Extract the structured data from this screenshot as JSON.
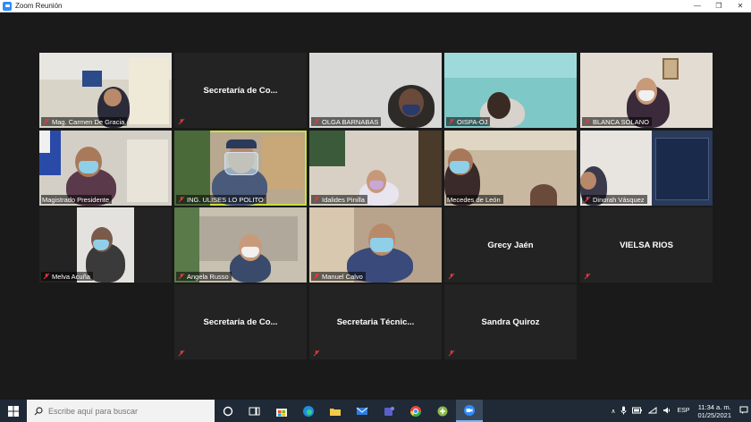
{
  "window": {
    "title": "Zoom Reunión",
    "minimize": "—",
    "restore": "❐",
    "close": "✕"
  },
  "participants": [
    {
      "name": "Mag. Carmen De Gracia",
      "video": true
    },
    {
      "name": "Secretaría de Co...",
      "video": false
    },
    {
      "name": "OLGA BARNABAS",
      "video": true
    },
    {
      "name": "OISPA-OJ",
      "video": true
    },
    {
      "name": "BLANCA SOLANO",
      "video": true
    },
    {
      "name": "Magistrado Presidente",
      "video": true
    },
    {
      "name": "ING. ULISES LO POLITO",
      "video": true,
      "active_speaker": true
    },
    {
      "name": "Idalides Pinilla",
      "video": true
    },
    {
      "name": "Mecedes de León",
      "video": true
    },
    {
      "name": "Dinorah Vásquez",
      "video": true
    },
    {
      "name": "Melva Acuña",
      "video": true
    },
    {
      "name": "Angela Russo",
      "video": true
    },
    {
      "name": "Manuel Calvo",
      "video": true
    },
    {
      "name": "Grecy Jaén",
      "video": false
    },
    {
      "name": "VIELSA RIOS",
      "video": false
    },
    {
      "name": "Secretaría de Co...",
      "video": false
    },
    {
      "name": "Secretaria Técnic...",
      "video": false
    },
    {
      "name": "Sandra Quiroz",
      "video": false
    }
  ],
  "taskbar": {
    "search_placeholder": "Escribe aquí para buscar",
    "language": "ESP",
    "time": "11:34 a. m.",
    "date": "01/25/2021"
  },
  "colors": {
    "active_speaker_border": "#c8e03a",
    "mute_icon": "#e03a3a",
    "taskbar": "#1f2a36"
  }
}
